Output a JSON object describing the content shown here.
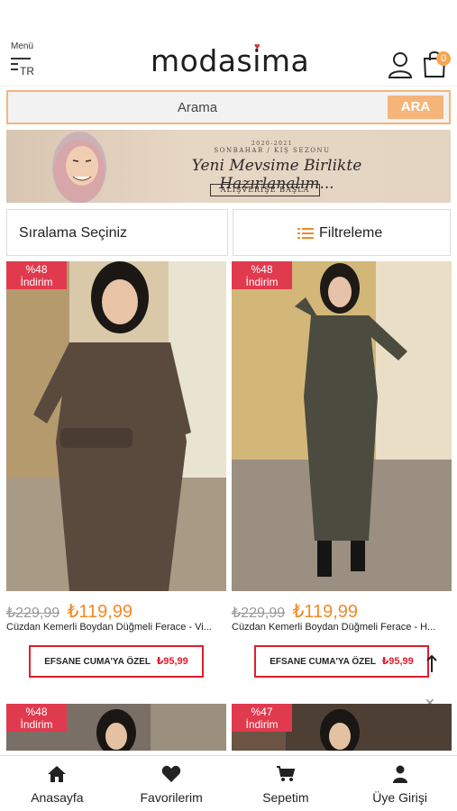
{
  "header": {
    "menu_label": "Menü",
    "lang": "TR",
    "logo": "modasima",
    "cart_count": "0"
  },
  "search": {
    "placeholder": "Arama",
    "button": "ARA"
  },
  "banner": {
    "top_text": "2020-2021",
    "season": "SONBAHAR / KIŞ SEZONU",
    "script": "Yeni Mevsime Birlikte Hazırlanalım...",
    "cta": "ALIŞVERİŞE BAŞLA"
  },
  "controls": {
    "sort_label": "Sıralama Seçiniz",
    "filter_label": "Filtreleme"
  },
  "products": [
    {
      "discount_pct": "%48",
      "discount_word": "İndirim",
      "old_price": "₺229,99",
      "new_price": "₺119,99",
      "name": "Cüzdan Kemerli Boydan Düğmeli Ferace - Vi...",
      "promo_label": "EFSANE CUMA'YA ÖZEL",
      "promo_price": "₺95,99"
    },
    {
      "discount_pct": "%48",
      "discount_word": "İndirim",
      "old_price": "₺229,99",
      "new_price": "₺119,99",
      "name": "Cüzdan Kemerli Boydan Düğmeli Ferace - H...",
      "promo_label": "EFSANE CUMA'YA ÖZEL",
      "promo_price": "₺95,99"
    },
    {
      "discount_pct": "%48",
      "discount_word": "İndirim"
    },
    {
      "discount_pct": "%47",
      "discount_word": "İndirim"
    }
  ],
  "bottom_nav": [
    {
      "label": "Anasayfa",
      "icon": "home-icon"
    },
    {
      "label": "Favorilerim",
      "icon": "heart-icon"
    },
    {
      "label": "Sepetim",
      "icon": "cart-icon"
    },
    {
      "label": "Üye Girişi",
      "icon": "user-icon"
    }
  ],
  "colors": {
    "accent": "#f5b57a",
    "price": "#f28a25",
    "discount": "#e03a4e",
    "promo_border": "#e11d2c"
  }
}
